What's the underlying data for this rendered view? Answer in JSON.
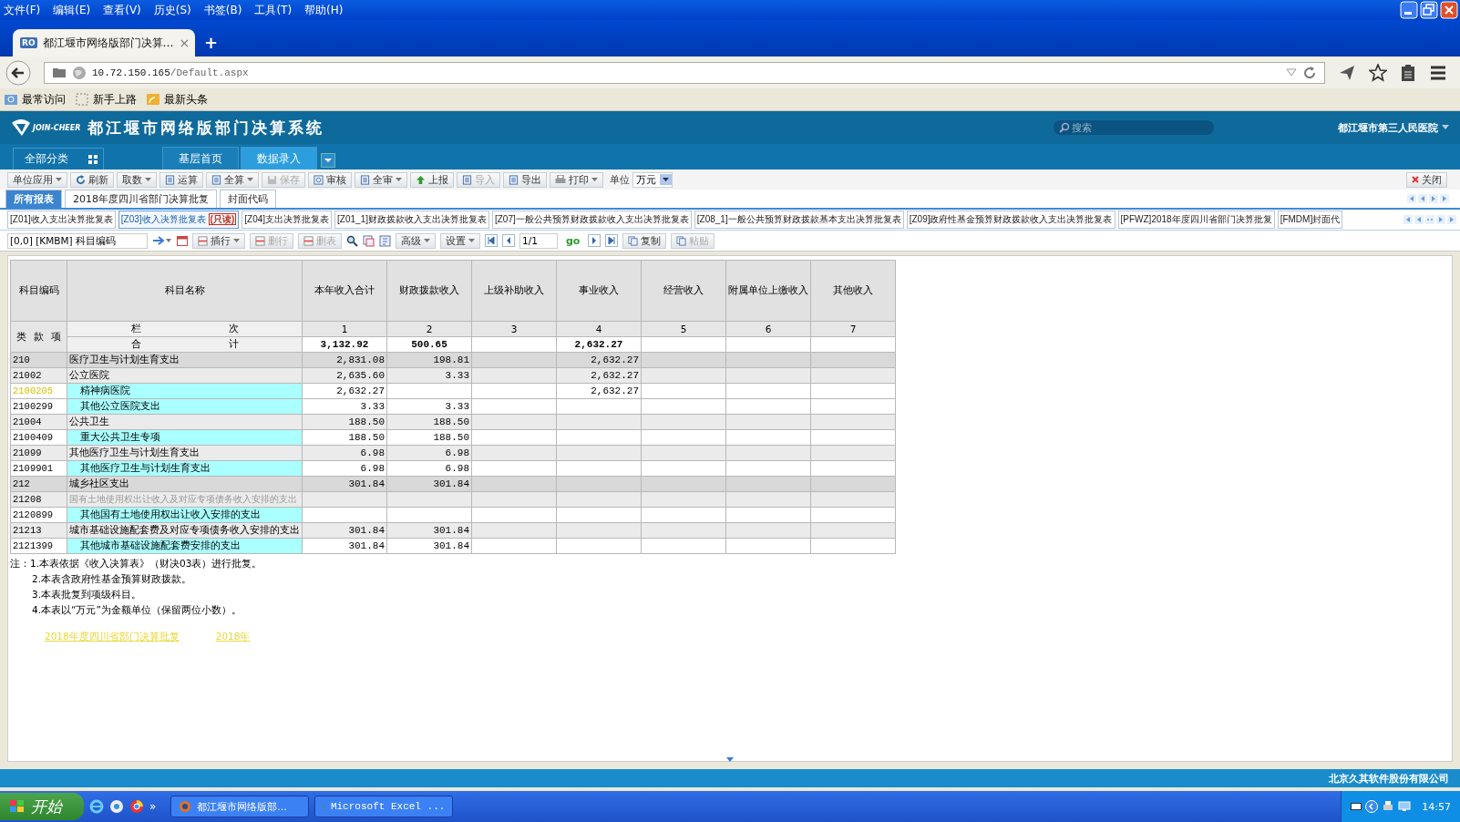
{
  "browser": {
    "menu": [
      "文件(F)",
      "编辑(E)",
      "查看(V)",
      "历史(S)",
      "书签(B)",
      "工具(T)",
      "帮助(H)"
    ],
    "tab": {
      "favicon": "RO",
      "title": "都江堰市网络版部门决算…",
      "close": "×"
    },
    "new_tab": "+",
    "url": {
      "host": "10.72.150.165",
      "path": "/Default.aspx"
    },
    "bookmarks": [
      "最常访问",
      "新手上路",
      "最新头条"
    ]
  },
  "app": {
    "logo": "JOIN-CHEER",
    "title": "都江堰市网络版部门决算系统",
    "search": {
      "placeholder": "搜索"
    },
    "user": "都江堰市第三人民医院",
    "category": "全部分类",
    "nav_tabs": [
      {
        "label": "基层首页",
        "selected": false
      },
      {
        "label": "数据录入",
        "selected": true
      }
    ]
  },
  "toolbar": {
    "buttons": [
      {
        "label": "单位应用",
        "dropdown": true,
        "disabled": false
      },
      {
        "label": "刷新",
        "dropdown": false,
        "disabled": false
      },
      {
        "label": "取数",
        "dropdown": true,
        "disabled": false
      },
      {
        "label": "运算",
        "dropdown": false,
        "disabled": false
      },
      {
        "label": "全算",
        "dropdown": true,
        "disabled": false
      },
      {
        "label": "保存",
        "dropdown": false,
        "disabled": true
      },
      {
        "label": "审核",
        "dropdown": false,
        "disabled": false
      },
      {
        "label": "全审",
        "dropdown": true,
        "disabled": false
      },
      {
        "label": "上报",
        "dropdown": false,
        "disabled": false
      },
      {
        "label": "导入",
        "dropdown": false,
        "disabled": true
      },
      {
        "label": "导出",
        "dropdown": false,
        "disabled": false
      },
      {
        "label": "打印",
        "dropdown": true,
        "disabled": false
      }
    ],
    "unit_label": "单位",
    "unit": "万元",
    "close": "关闭"
  },
  "report_tabs": [
    {
      "label": "所有报表",
      "selected": true
    },
    {
      "label": "2018年度四川省部门决算批复",
      "selected": false
    },
    {
      "label": "封面代码",
      "selected": false
    }
  ],
  "sheet_tabs": [
    {
      "label": "[Z01]收入支出决算批复表",
      "selected": false
    },
    {
      "label": "[Z03]收入决算批复表",
      "badge": "(只读)",
      "selected": true
    },
    {
      "label": "[Z04]支出决算批复表",
      "selected": false
    },
    {
      "label": "[Z01_1]财政拨款收入支出决算批复表",
      "selected": false
    },
    {
      "label": "[Z07]一般公共预算财政拨款收入支出决算批复表",
      "selected": false
    },
    {
      "label": "[Z08_1]一般公共预算财政拨款基本支出决算批复表",
      "selected": false
    },
    {
      "label": "[Z09]政府性基金预算财政拨款收入支出决算批复表",
      "selected": false
    },
    {
      "label": "[PFWZ]2018年度四川省部门决算批复",
      "selected": false
    },
    {
      "label": "[FMDM]封面代",
      "selected": false
    }
  ],
  "edit_bar": {
    "cell_ref": "[0,0] [KMBM] 科目编码",
    "row_buttons": [
      {
        "label": "插行",
        "dropdown": true,
        "disabled": false
      },
      {
        "label": "删行",
        "dropdown": false,
        "disabled": true
      },
      {
        "label": "删表",
        "dropdown": false,
        "disabled": true
      }
    ],
    "menu_buttons": [
      {
        "label": "高级",
        "dropdown": true,
        "disabled": false
      },
      {
        "label": "设置",
        "dropdown": true,
        "disabled": false
      }
    ],
    "page": "1/1",
    "go": "go",
    "clip_buttons": [
      {
        "label": "复制",
        "disabled": false
      },
      {
        "label": "粘贴",
        "disabled": true
      }
    ]
  },
  "table": {
    "columns": [
      "科目编码",
      "科目名称",
      "本年收入合计",
      "财政拨款收入",
      "上级补助收入",
      "事业收入",
      "经营收入",
      "附属单位上缴收入",
      "其他收入"
    ],
    "level_label": [
      "类",
      "款",
      "项"
    ],
    "column_no_label": [
      "栏",
      "次"
    ],
    "column_numbers": [
      "1",
      "2",
      "3",
      "4",
      "5",
      "6",
      "7"
    ],
    "total_label": [
      "合",
      "计"
    ],
    "totals": {
      "col_1": "3,132.92",
      "col_2": "500.65",
      "col_4": "2,632.27"
    },
    "rows": [
      {
        "code": "210",
        "name": "医疗卫生与计划生育支出",
        "kind": "lei",
        "selected": false,
        "muted": false,
        "values": {
          "col_1": "2,831.08",
          "col_2": "198.81",
          "col_4": "2,632.27"
        }
      },
      {
        "code": "21002",
        "name": "公立医院",
        "kind": "kuan",
        "selected": false,
        "muted": false,
        "values": {
          "col_1": "2,635.60",
          "col_2": "3.33",
          "col_4": "2,632.27"
        }
      },
      {
        "code": "2100205",
        "name": "精神病医院",
        "kind": "xiang",
        "selected": true,
        "muted": false,
        "values": {
          "col_1": "2,632.27",
          "col_4": "2,632.27"
        }
      },
      {
        "code": "2100299",
        "name": "其他公立医院支出",
        "kind": "xiang",
        "selected": false,
        "muted": false,
        "values": {
          "col_1": "3.33",
          "col_2": "3.33"
        }
      },
      {
        "code": "21004",
        "name": "公共卫生",
        "kind": "kuan",
        "selected": false,
        "muted": false,
        "values": {
          "col_1": "188.50",
          "col_2": "188.50"
        }
      },
      {
        "code": "2100409",
        "name": "重大公共卫生专项",
        "kind": "xiang",
        "selected": false,
        "muted": false,
        "values": {
          "col_1": "188.50",
          "col_2": "188.50"
        }
      },
      {
        "code": "21099",
        "name": "其他医疗卫生与计划生育支出",
        "kind": "kuan",
        "selected": false,
        "muted": false,
        "values": {
          "col_1": "6.98",
          "col_2": "6.98"
        }
      },
      {
        "code": "2109901",
        "name": "其他医疗卫生与计划生育支出",
        "kind": "xiang",
        "selected": false,
        "muted": false,
        "values": {
          "col_1": "6.98",
          "col_2": "6.98"
        }
      },
      {
        "code": "212",
        "name": "城乡社区支出",
        "kind": "lei",
        "selected": false,
        "muted": false,
        "values": {
          "col_1": "301.84",
          "col_2": "301.84"
        }
      },
      {
        "code": "21208",
        "name": "国有土地使用权出让收入及对应专项债务收入安排的支出",
        "kind": "kuan",
        "selected": false,
        "muted": true
      },
      {
        "code": "2120899",
        "name": "其他国有土地使用权出让收入安排的支出",
        "kind": "xiang",
        "selected": false,
        "muted": false
      },
      {
        "code": "21213",
        "name": "城市基础设施配套费及对应专项债务收入安排的支出",
        "kind": "kuan",
        "selected": false,
        "muted": false,
        "values": {
          "col_1": "301.84",
          "col_2": "301.84"
        }
      },
      {
        "code": "2121399",
        "name": "其他城市基础设施配套费安排的支出",
        "kind": "xiang",
        "selected": false,
        "muted": false,
        "values": {
          "col_1": "301.84",
          "col_2": "301.84"
        }
      }
    ]
  },
  "notes": [
    "注：1.本表依据《收入决算表》（财决03表）进行批复。",
    "2.本表含政府性基金预算财政拨款。",
    "3.本表批复到项级科目。",
    "4.本表以“万元”为金额单位（保留两位小数）。"
  ],
  "links": [
    "2018年度四川省部门决算批复",
    "2018年"
  ],
  "footer": "北京久其软件股份有限公司",
  "taskbar": {
    "start": "开始",
    "more": "»",
    "tasks": [
      "都江堰市网络版部...",
      "Microsoft Excel ..."
    ],
    "clock": "14:57"
  }
}
